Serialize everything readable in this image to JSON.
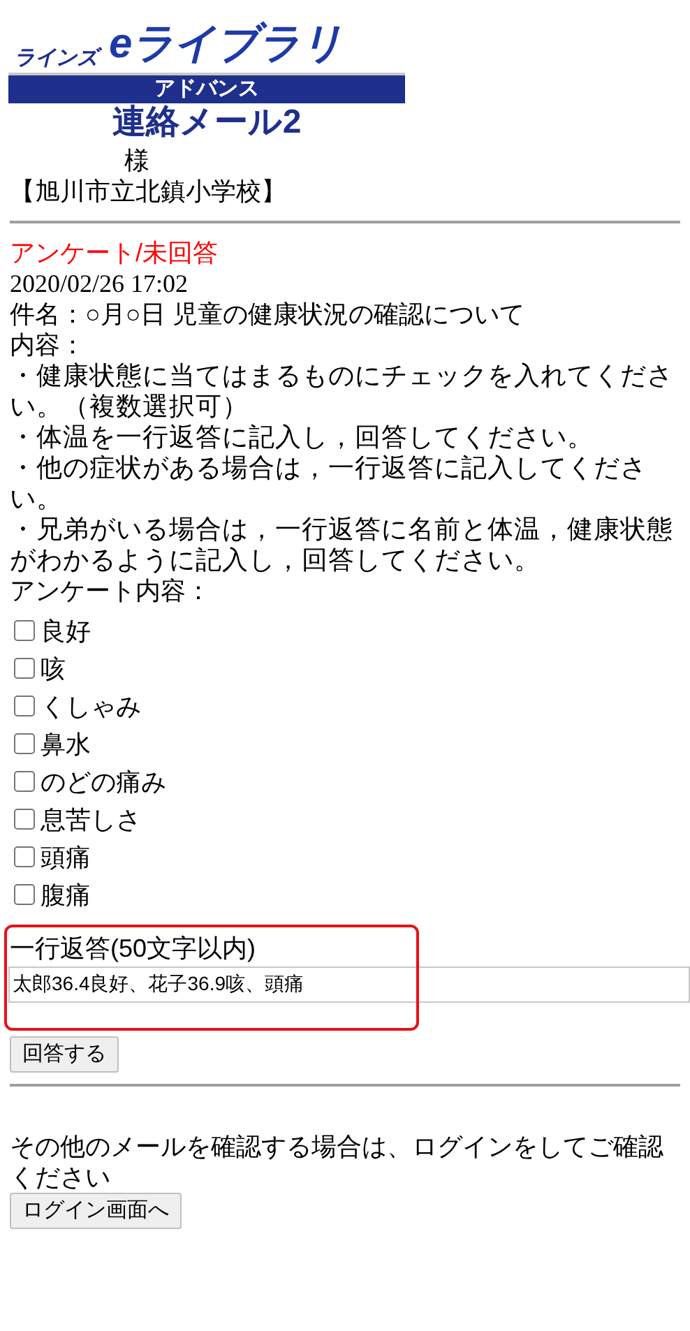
{
  "logo": {
    "brand": "ラインズ",
    "product": "eライブラリ",
    "edition": "アドバンス",
    "service": "連絡メール2"
  },
  "recipient": {
    "honorific": "様",
    "school": "【旭川市立北鎮小学校】"
  },
  "survey": {
    "status": "アンケート/未回答",
    "datetime": "2020/02/26 17:02",
    "subject": "件名：○月○日 児童の健康状況の確認について",
    "content_label": "内容：",
    "content_lines": [
      "・健康状態に当てはまるものにチェックを入れてください。（複数選択可）",
      "・体温を一行返答に記入し，回答してください。",
      "・他の症状がある場合は，一行返答に記入してください。",
      "・兄弟がいる場合は，一行返答に名前と体温，健康状態がわかるように記入し，回答してください。"
    ],
    "options_label": "アンケート内容：",
    "options": [
      {
        "label": "良好",
        "checked": false
      },
      {
        "label": "咳",
        "checked": false
      },
      {
        "label": "くしゃみ",
        "checked": false
      },
      {
        "label": "鼻水",
        "checked": false
      },
      {
        "label": "のどの痛み",
        "checked": false
      },
      {
        "label": "息苦しさ",
        "checked": false
      },
      {
        "label": "頭痛",
        "checked": false
      },
      {
        "label": "腹痛",
        "checked": false
      }
    ],
    "reply_label": "一行返答(50文字以内)",
    "reply_value": "太郎36.4良好、花子36.9咳、頭痛",
    "submit_button": "回答する"
  },
  "footer": {
    "message": "その他のメールを確認する場合は、ログインをしてご確認ください",
    "login_button": "ログイン画面へ"
  }
}
